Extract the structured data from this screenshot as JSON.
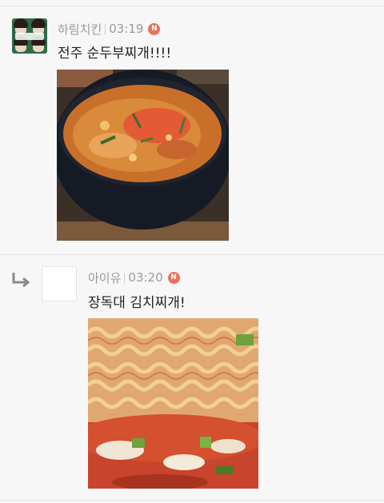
{
  "comments": [
    {
      "author": "하림치킨",
      "time": "03:19",
      "badge": "N",
      "text": "전주 순두부찌개!!!!",
      "avatar": "profile-photo",
      "image": "sundubu-jjigae-photo"
    },
    {
      "author": "아이유",
      "time": "03:20",
      "badge": "N",
      "text": "장독대 김치찌개!",
      "avatar": "blank-profile",
      "image": "kimchi-jjigae-photo",
      "is_reply": true
    }
  ],
  "colors": {
    "background": "#f7f7f7",
    "meta_text": "#9a9a9a",
    "badge": "#e8725a",
    "divider": "#e2e2e2"
  },
  "icons": {
    "reply": "reply-arrow-icon",
    "badge": "new-badge"
  }
}
